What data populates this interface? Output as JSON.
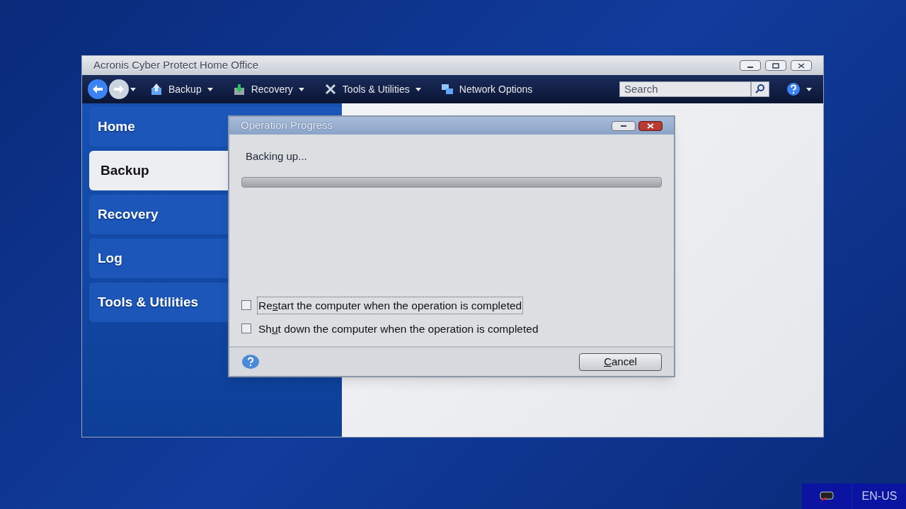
{
  "window": {
    "title": "Acronis Cyber Protect Home Office"
  },
  "toolbar": {
    "items": [
      {
        "label": "Backup",
        "has_menu": true
      },
      {
        "label": "Recovery",
        "has_menu": true
      },
      {
        "label": "Tools & Utilities",
        "has_menu": true
      },
      {
        "label": "Network Options",
        "has_menu": false
      }
    ],
    "search": {
      "placeholder": "Search"
    }
  },
  "sidebar": {
    "items": [
      {
        "label": "Home",
        "selected": false
      },
      {
        "label": "Backup",
        "selected": true
      },
      {
        "label": "Recovery",
        "selected": false
      },
      {
        "label": "Log",
        "selected": false
      },
      {
        "label": "Tools & Utilities",
        "selected": false
      }
    ]
  },
  "dialog": {
    "title": "Operation Progress",
    "status": "Backing up...",
    "progress": {
      "level": 0
    },
    "options": [
      {
        "before": "Re",
        "key": "s",
        "after": "tart the computer when the operation is completed",
        "checked": false,
        "focused": true
      },
      {
        "before": "Sh",
        "key": "u",
        "after": "t down the computer when the operation is completed",
        "checked": false,
        "focused": false
      }
    ],
    "cancel": {
      "key": "C",
      "after": "ancel"
    }
  },
  "taskbar": {
    "language": "EN-US"
  }
}
